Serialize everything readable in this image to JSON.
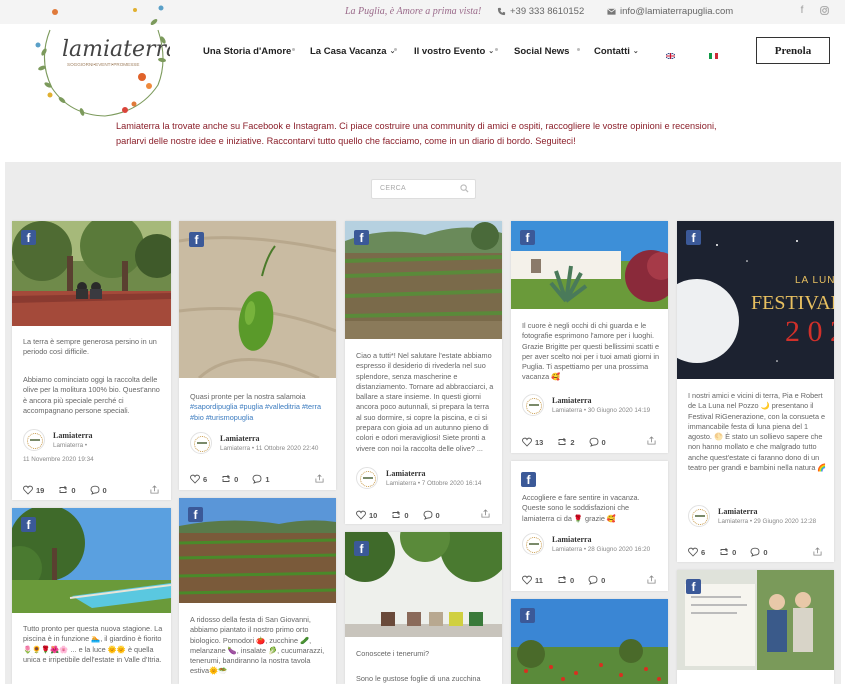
{
  "topbar": {
    "tagline": "La Puglia, è Amore a prima vista!",
    "phone": "+39 333 8610152",
    "email": "info@lamiaterrapuglia.com",
    "social_icons": [
      "facebook-icon",
      "instagram-icon"
    ]
  },
  "logo": {
    "name": "lamiaterra",
    "subtitle": "SOGGIORNI•EVENTI•PROMESSE"
  },
  "nav": {
    "items": [
      {
        "label": "Una Storia d'Amore"
      },
      {
        "label": "La Casa Vacanza"
      },
      {
        "label": "Il vostro Evento"
      },
      {
        "label": "Social News"
      },
      {
        "label": "Contatti"
      }
    ],
    "cta": "Prenola"
  },
  "intro": "Lamiaterra la trovate anche su Facebook e Instagram. Ci piace costruire una community di amici e ospiti, raccogliere le vostre opinioni e recensioni, parlarvi delle nostre idee e iniziative. Raccontarvi tutto quello che facciamo, come in un diario di bordo. Seguiteci!",
  "search": {
    "placeholder": "CERCA"
  },
  "colors": {
    "facebook": "#3b5998",
    "intro_text": "#8b1f2a",
    "hashtag": "#3b7bbf"
  },
  "posts": [
    {
      "text1": "La terra è sempre generosa persino in un periodo così difficile.",
      "text2": "Abbiamo cominciato oggi la raccolta delle olive per la molitura 100% bio. Quest'anno è ancora più speciale perché ci accompagnano persone speciali.",
      "author": "Lamiaterra",
      "author_sub": "Lamiaterra •",
      "date": "11 Novembre 2020 19:34",
      "likes": "19",
      "retweets": "0",
      "comments": "0"
    },
    {
      "text1": "Quasi pronte per la nostra salamoia",
      "tags": "#sapordipuglia #puglia #valleditria #terra #bio #turismopuglia",
      "author": "Lamiaterra",
      "date": "Lamiaterra • 11 Ottobre 2020 22:40",
      "likes": "6",
      "retweets": "0",
      "comments": "1"
    },
    {
      "text1": "Ciao a tutti*! Nel salutare l'estate abbiamo espresso il desiderio di rivederla nel suo splendore, senza mascherine e distanziamento. Tornare ad abbracciarci, a ballare a stare insieme. In questi giorni ancora poco autunnali, si prepara la terra al suo dormire, si copre la piscina, e ci si prepara con gioia ad un autunno pieno di colori e odori meravigliosi! Siete pronti a vivere con noi la raccolta delle olive? ...",
      "author": "Lamiaterra",
      "date": "Lamiaterra • 7 Ottobre 2020 16:14",
      "likes": "10",
      "retweets": "0",
      "comments": "0"
    },
    {
      "text1": "Il cuore è negli occhi di chi guarda e le fotografie esprimono l'amore per i luoghi. Grazie Brigitte per questi bellissimi scatti e per aver scelto noi per i tuoi amati giorni in Puglia. Ti aspettiamo per una prossima vacanza 🥰",
      "author": "Lamiaterra",
      "date": "Lamiaterra • 30 Giugno 2020 14:19",
      "likes": "13",
      "retweets": "2",
      "comments": "0"
    },
    {
      "text1": "Accogliere e fare sentire in vacanza. Queste sono le soddisfazioni che lamiaterra ci da 🌹 grazie 🥰",
      "author": "Lamiaterra",
      "date": "Lamiaterra • 28 Giugno 2020 16:20",
      "likes": "11",
      "retweets": "0",
      "comments": "0"
    },
    {
      "img_title": "LA LUNA",
      "img_big": "FESTIVAL E",
      "img_year": "2 0 2",
      "text1": "I nostri amici e vicini di terra, Pia e Robert de La Luna nel Pozzo 🌙 presentano il Festival RiGenerazione, con la consueta e immancabile festa di luna piena del 1 agosto. 🌕 È stato un sollievo sapere che non hanno mollato e che malgrado tutto anche quest'estate ci faranno dono di un teatro per grandi e bambini nella natura 🌈",
      "author": "Lamiaterra",
      "date": "Lamiaterra • 29 Giugno 2020 12:28",
      "likes": "6",
      "retweets": "0",
      "comments": "0"
    },
    {
      "text1": "Tutto pronto per questa nuova stagione. La piscina è in funzione 🏊, il giardino è fiorito 🌷🌻🌹🌺🌸 ... e la luce 🌞🌞 è quella unica e irripetibile dell'estate in Valle d'Itria."
    },
    {
      "text1": "A ridosso della festa di San Giovanni, abbiamo piantato il nostro primo orto biologico. Pomodori 🍅, zucchine 🥒, melanzane 🍆, insalate 🥬, cucumarazzi, tenerumi, bandiranno la nostra tavola estiva🌞🥗"
    },
    {
      "text1": "Conoscete i tenerumi?",
      "text2": "Sono le gustose foglie di una zucchina"
    }
  ]
}
